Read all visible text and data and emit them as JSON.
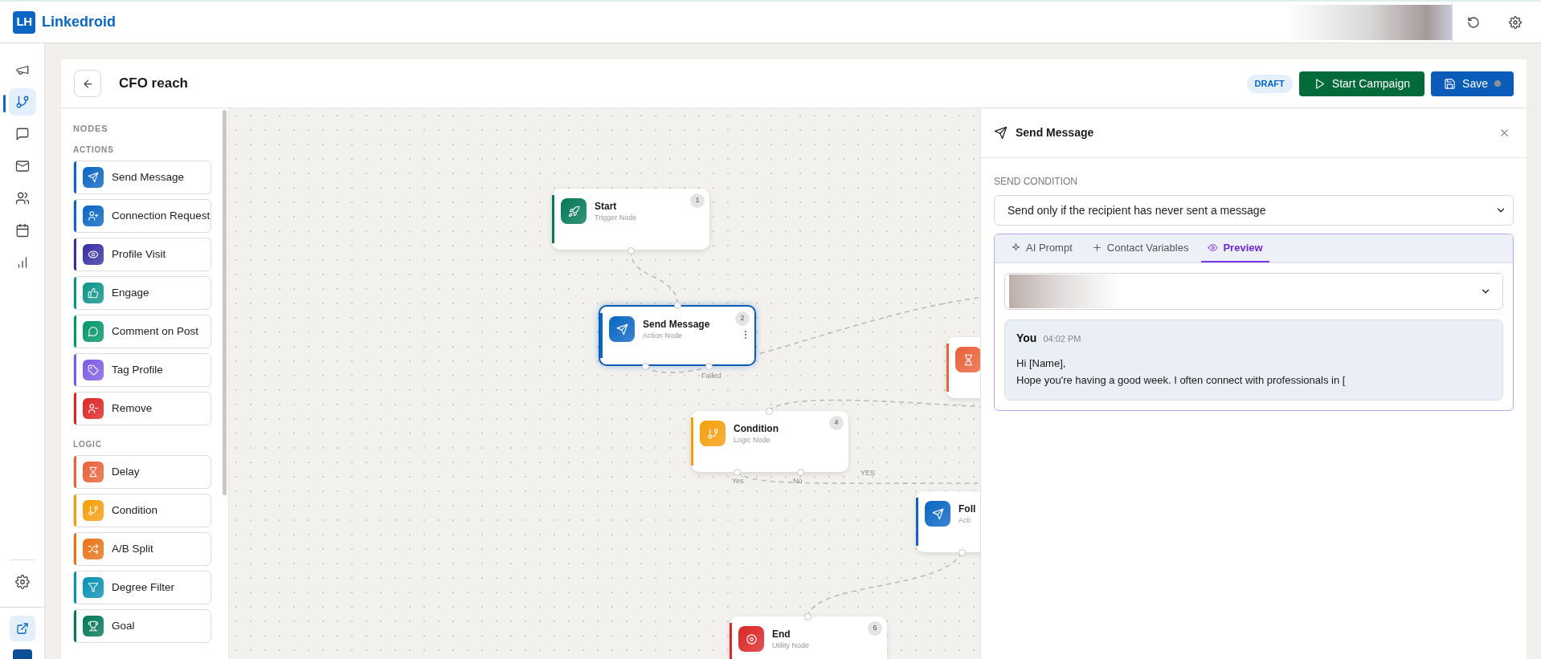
{
  "app": {
    "logo": "LH",
    "name": "Linkedroid"
  },
  "rail": [
    {
      "kind": "megaphone",
      "selected": false
    },
    {
      "kind": "branch",
      "selected": true
    },
    {
      "kind": "chat",
      "selected": false
    },
    {
      "kind": "mail",
      "selected": false
    },
    {
      "kind": "users",
      "selected": false
    },
    {
      "kind": "calendar",
      "selected": false
    },
    {
      "kind": "chart",
      "selected": false
    }
  ],
  "campaign": {
    "title": "CFO reach",
    "status": "DRAFT",
    "start_label": "Start Campaign",
    "save_label": "Save"
  },
  "nodes_panel": {
    "title": "NODES",
    "sections": [
      {
        "title": "ACTIONS",
        "items": [
          {
            "label": "Send Message",
            "kind": "send",
            "color": "#0a66c2"
          },
          {
            "label": "Connection Request",
            "kind": "user_plus",
            "color": "#0a66c2"
          },
          {
            "label": "Profile Visit",
            "kind": "eye",
            "color": "#3730a3"
          },
          {
            "label": "Engage",
            "kind": "thumb",
            "color": "#0d9488"
          },
          {
            "label": "Comment on Post",
            "kind": "comment",
            "color": "#059669"
          },
          {
            "label": "Tag Profile",
            "kind": "tag",
            "color": "#7c5ce6"
          },
          {
            "label": "Remove",
            "kind": "user_minus",
            "color": "#dc2626"
          }
        ]
      },
      {
        "title": "LOGIC",
        "items": [
          {
            "label": "Delay",
            "kind": "hourglass",
            "color": "#e8623a"
          },
          {
            "label": "Condition",
            "kind": "branch",
            "color": "#f59e0b"
          },
          {
            "label": "A/B Split",
            "kind": "shuffle",
            "color": "#e8741a"
          },
          {
            "label": "Degree Filter",
            "kind": "filter",
            "color": "#0891b2"
          },
          {
            "label": "Goal",
            "kind": "trophy",
            "color": "#047857"
          }
        ]
      }
    ]
  },
  "canvas": {
    "nodes": [
      {
        "kind": "rocket",
        "title": "Start",
        "subtitle": "Trigger Node",
        "number": "1",
        "color": "#047857",
        "selected": false
      },
      {
        "kind": "send",
        "title": "Send Message",
        "subtitle": "Action Node",
        "number": "2",
        "color": "#0a66c2",
        "selected": true
      },
      {
        "kind": "branch",
        "title": "Condition",
        "subtitle": "Logic Node",
        "number": "4",
        "color": "#f59e0b",
        "selected": false
      },
      {
        "kind": "hourglass",
        "color": "#e8623a",
        "selected": false
      },
      {
        "kind": "send",
        "title": "Foll",
        "subtitle": "Acti",
        "color": "#0a66c2",
        "selected": false
      },
      {
        "kind": "target",
        "title": "End",
        "subtitle": "Utility Node",
        "number": "6",
        "color": "#dc2626",
        "selected": false
      }
    ],
    "edge_labels": [
      "Failed",
      "Yes",
      "No",
      "YES"
    ]
  },
  "panel": {
    "title": "Send Message",
    "send_condition": {
      "label": "SEND CONDITION",
      "value": "Send only if the recipient has never sent a message"
    },
    "tabs": [
      {
        "kind": "sparkles",
        "label": "AI Prompt",
        "selected": false
      },
      {
        "kind": "plus",
        "label": "Contact Variables",
        "selected": false
      },
      {
        "kind": "eye",
        "label": "Preview",
        "selected": true
      }
    ],
    "message": {
      "sender": "You",
      "time": "04:02 PM",
      "lines": [
        "Hi [Name],",
        "Hope you're having a good week. I often connect with professionals in ["
      ]
    }
  }
}
